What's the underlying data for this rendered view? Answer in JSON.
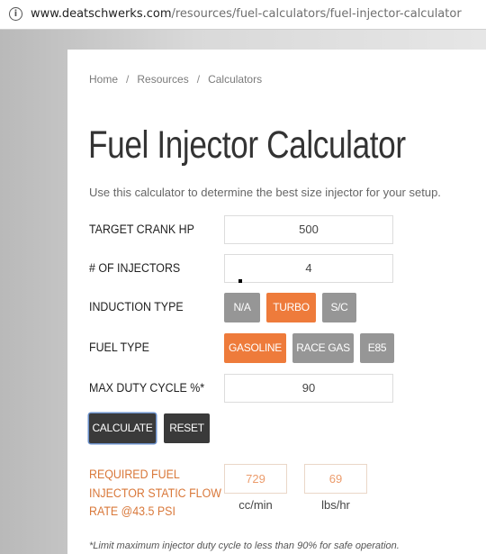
{
  "browser": {
    "url_domain": "www.deatschwerks.com",
    "url_path": "/resources/fuel-calculators/fuel-injector-calculator",
    "info_icon": "info-icon"
  },
  "breadcrumb": {
    "items": [
      "Home",
      "Resources",
      "Calculators"
    ],
    "separator": "/"
  },
  "page": {
    "title": "Fuel Injector Calculator",
    "intro": "Use this calculator to determine the best size injector for your setup."
  },
  "form": {
    "crank_hp": {
      "label": "TARGET CRANK HP",
      "value": "500"
    },
    "injectors": {
      "label": "# OF INJECTORS",
      "value": "4"
    },
    "induction": {
      "label": "INDUCTION TYPE",
      "options": [
        "N/A",
        "TURBO",
        "S/C"
      ],
      "selected": "TURBO"
    },
    "fuel": {
      "label": "FUEL TYPE",
      "options": [
        "GASOLINE",
        "RACE GAS",
        "E85"
      ],
      "selected": "GASOLINE"
    },
    "duty": {
      "label": "MAX DUTY CYCLE %*",
      "value": "90"
    },
    "calculate_label": "CALCULATE",
    "reset_label": "RESET"
  },
  "result": {
    "label": "REQUIRED FUEL\nINJECTOR STATIC FLOW\nRATE @43.5 PSI",
    "ccmin_value": "729",
    "ccmin_unit": "cc/min",
    "lbshr_value": "69",
    "lbshr_unit": "lbs/hr"
  },
  "footnote": "*Limit maximum injector duty cycle to less than 90% for safe operation.",
  "colors": {
    "accent": "#ee7b3b",
    "button_gray": "#969696",
    "button_dark": "#3a3a3a",
    "result_text": "#d9783a"
  }
}
